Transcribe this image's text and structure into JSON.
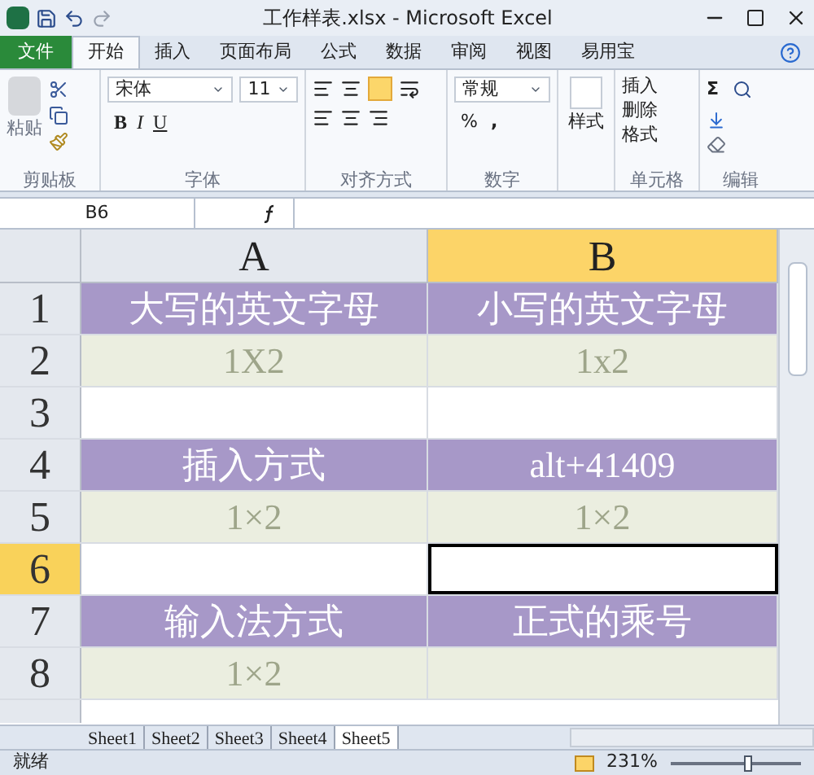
{
  "window": {
    "title": "工作样表.xlsx - Microsoft Excel"
  },
  "tabs": [
    {
      "label": "文件",
      "kind": "file",
      "selected": false
    },
    {
      "label": "开始",
      "kind": "tab",
      "selected": true
    },
    {
      "label": "插入",
      "kind": "tab",
      "selected": false
    },
    {
      "label": "页面布局",
      "kind": "tab",
      "selected": false
    },
    {
      "label": "公式",
      "kind": "tab",
      "selected": false
    },
    {
      "label": "数据",
      "kind": "tab",
      "selected": false
    },
    {
      "label": "审阅",
      "kind": "tab",
      "selected": false
    },
    {
      "label": "视图",
      "kind": "tab",
      "selected": false
    },
    {
      "label": "易用宝",
      "kind": "tab",
      "selected": false
    }
  ],
  "ribbon": {
    "paste": "粘贴",
    "font_name": "宋体",
    "font_size": "11",
    "bold": "B",
    "italic": "I",
    "underline": "U",
    "number_format": "常规",
    "percent": "%",
    "comma": ",",
    "styles": "样式",
    "insert": "插入",
    "delete": "删除",
    "format": "格式",
    "sum": "Σ",
    "groups": [
      "剪贴板",
      "字体",
      "对齐方式",
      "数字",
      "单元格",
      "编辑"
    ]
  },
  "formula_bar": {
    "name_box": "B6"
  },
  "columns": [
    {
      "label": "A",
      "selected": false
    },
    {
      "label": "B",
      "selected": true
    }
  ],
  "rows": [
    {
      "label": "1",
      "kind": "heading",
      "selected": false,
      "cells": [
        {
          "text": "大写的英文字母",
          "selected": false
        },
        {
          "text": "小写的英文字母",
          "selected": false
        }
      ]
    },
    {
      "label": "2",
      "kind": "value",
      "selected": false,
      "cells": [
        {
          "text": "1X2",
          "selected": false
        },
        {
          "text": "1x2",
          "selected": false
        }
      ]
    },
    {
      "label": "3",
      "kind": "empty",
      "selected": false,
      "cells": [
        {
          "text": "",
          "selected": false
        },
        {
          "text": "",
          "selected": false
        }
      ]
    },
    {
      "label": "4",
      "kind": "heading",
      "selected": false,
      "cells": [
        {
          "text": "插入方式",
          "selected": false
        },
        {
          "text": "alt+41409",
          "selected": false
        }
      ]
    },
    {
      "label": "5",
      "kind": "value",
      "selected": false,
      "cells": [
        {
          "text": "1×2",
          "selected": false
        },
        {
          "text": "1×2",
          "selected": false
        }
      ]
    },
    {
      "label": "6",
      "kind": "empty",
      "selected": true,
      "cells": [
        {
          "text": "",
          "selected": false
        },
        {
          "text": "",
          "selected": true
        }
      ]
    },
    {
      "label": "7",
      "kind": "heading",
      "selected": false,
      "cells": [
        {
          "text": "输入法方式",
          "selected": false
        },
        {
          "text": "正式的乘号",
          "selected": false
        }
      ]
    },
    {
      "label": "8",
      "kind": "value",
      "selected": false,
      "cells": [
        {
          "text": "1×2",
          "selected": false
        },
        {
          "text": "",
          "selected": false
        }
      ]
    }
  ],
  "sheets": [
    {
      "label": "Sheet1",
      "selected": false
    },
    {
      "label": "Sheet2",
      "selected": false
    },
    {
      "label": "Sheet3",
      "selected": false
    },
    {
      "label": "Sheet4",
      "selected": false
    },
    {
      "label": "Sheet5",
      "selected": true
    }
  ],
  "status_bar": {
    "status": "就绪",
    "zoom": "231%",
    "zoom_slider": {
      "level": 0.6
    }
  }
}
